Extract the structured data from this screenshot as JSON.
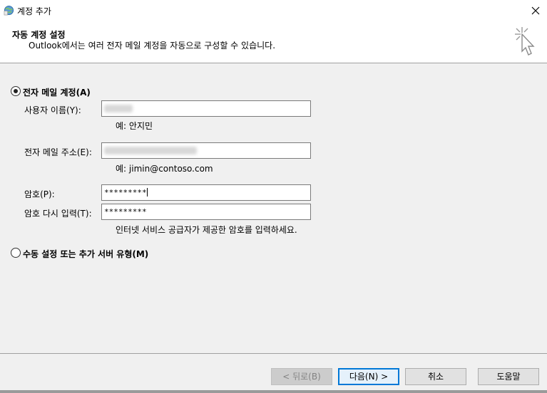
{
  "window": {
    "title": "계정 추가"
  },
  "header": {
    "title": "자동 계정 설정",
    "subtitle": "Outlook에서는 여러 전자 메일 계정을 자동으로 구성할 수 있습니다."
  },
  "form": {
    "option_auto": "전자 메일 계정(A)",
    "name_label": "사용자 이름(Y):",
    "name_value": "",
    "name_hint": "예: 안지민",
    "email_label": "전자 메일 주소(E):",
    "email_value": "",
    "email_hint": "예: jimin@contoso.com",
    "password_label": "암호(P):",
    "password_value": "*********",
    "password_confirm_label": "암호 다시 입력(T):",
    "password_confirm_value": "*********",
    "password_hint": "인터넷 서비스 공급자가 제공한 암호를 입력하세요.",
    "option_manual": "수동 설정 또는 추가 서버 유형(M)"
  },
  "buttons": {
    "back": "< 뒤로(B)",
    "next": "다음(N) >",
    "cancel": "취소",
    "help": "도움말"
  }
}
